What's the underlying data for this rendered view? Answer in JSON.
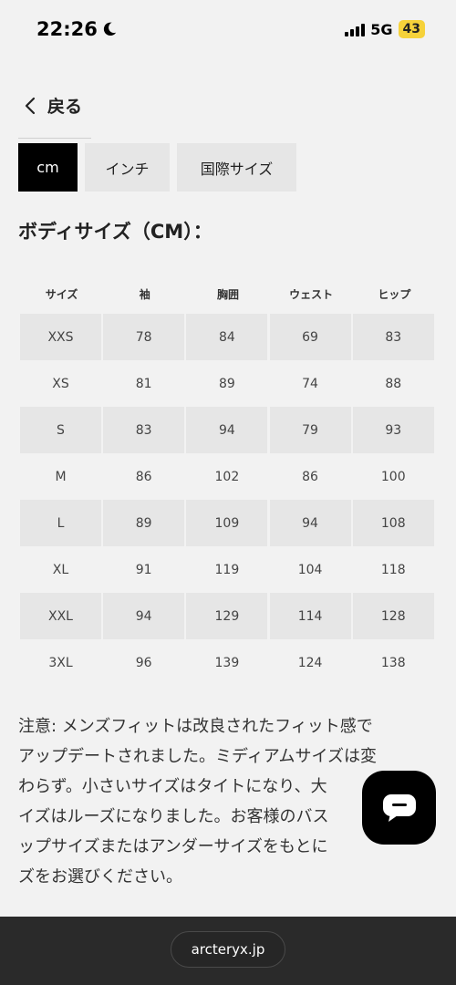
{
  "status_bar": {
    "time": "22:26",
    "network": "5G",
    "battery": "43"
  },
  "nav": {
    "back_label": "戻る"
  },
  "unit_tabs": [
    {
      "label": "cm",
      "active": true
    },
    {
      "label": "インチ",
      "active": false
    },
    {
      "label": "国際サイズ",
      "active": false
    }
  ],
  "heading": "ボディサイズ（CM）：",
  "table": {
    "headers": [
      "サイズ",
      "袖",
      "胸囲",
      "ウェスト",
      "ヒップ"
    ],
    "rows": [
      [
        "XXS",
        "78",
        "84",
        "69",
        "83"
      ],
      [
        "XS",
        "81",
        "89",
        "74",
        "88"
      ],
      [
        "S",
        "83",
        "94",
        "79",
        "93"
      ],
      [
        "M",
        "86",
        "102",
        "86",
        "100"
      ],
      [
        "L",
        "89",
        "109",
        "94",
        "108"
      ],
      [
        "XL",
        "91",
        "119",
        "104",
        "118"
      ],
      [
        "XXL",
        "94",
        "129",
        "114",
        "128"
      ],
      [
        "3XL",
        "96",
        "139",
        "124",
        "138"
      ]
    ]
  },
  "note": {
    "lines": [
      "注意: メンズフィットは改良されたフィット感で",
      "アップデートされました。ミディアムサイズは変",
      "わらず。小さいサイズはタイトになり、大",
      "イズはルーズになりました。お客様のバス",
      "ップサイズまたはアンダーサイズをもとに",
      "ズをお選びください。"
    ]
  },
  "bottom_bar": {
    "url": "arcteryx.jp"
  },
  "colors": {
    "active_tab": "#000000",
    "inactive_tab": "#e6e6e6",
    "background": "#f2f2f2",
    "battery": "#f6d23a"
  }
}
